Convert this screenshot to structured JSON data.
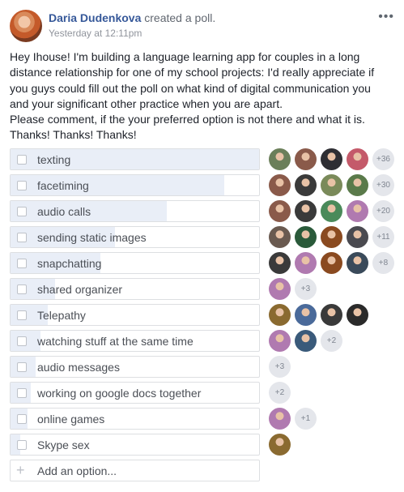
{
  "post": {
    "author_name": "Daria Dudenkova",
    "action_text": "created a poll.",
    "timestamp": "Yesterday at 12:11pm",
    "more_label": "•••",
    "text_lines": [
      "Hey Ihouse! I'm building a language learning app for couples in a long",
      "distance relationship for one of my school projects: I'd really appreciate if",
      "you guys could fill out the poll on what kind of digital communication you",
      "and your significant other practice when you are apart.",
      "Please comment, if the your preferred option is not there and what it is.",
      "Thanks! Thanks! Thanks!"
    ]
  },
  "poll": {
    "options": [
      {
        "label": "texting",
        "fill": 1.0,
        "voters": [
          "#6b7f5a",
          "#8a5a4a",
          "#2e2e33",
          "#c45a6a"
        ],
        "more": "+36"
      },
      {
        "label": "facetiming",
        "fill": 0.86,
        "voters": [
          "#8a5a4a",
          "#3a3a3a",
          "#7a8a5a",
          "#5a7a4a"
        ],
        "more": "+30"
      },
      {
        "label": "audio calls",
        "fill": 0.63,
        "voters": [
          "#8a5a4a",
          "#3a3a3a",
          "#4a8a5a",
          "#b07ab0"
        ],
        "more": "+20"
      },
      {
        "label": "sending static images",
        "fill": 0.42,
        "voters": [
          "#6a5a50",
          "#2a5a3a",
          "#8a4a20",
          "#4a4a50"
        ],
        "more": "+11"
      },
      {
        "label": "snapchatting",
        "fill": 0.36,
        "voters": [
          "#3a3a3a",
          "#b07ab0",
          "#8a4a20",
          "#3a4a5a"
        ],
        "more": "+8"
      },
      {
        "label": "shared organizer",
        "fill": 0.18,
        "voters": [
          "#b07ab0"
        ],
        "more": "+3"
      },
      {
        "label": "Telepathy",
        "fill": 0.15,
        "voters": [
          "#8a6a30",
          "#4a6a9a",
          "#3a3a3a",
          "#2a2a2a"
        ],
        "more": ""
      },
      {
        "label": "watching stuff at the same time",
        "fill": 0.12,
        "voters": [
          "#b07ab0",
          "#3a5a7a"
        ],
        "more": "+2"
      },
      {
        "label": "audio messages",
        "fill": 0.1,
        "voters": [],
        "more": "+3"
      },
      {
        "label": "working on google docs together",
        "fill": 0.08,
        "voters": [],
        "more": "+2"
      },
      {
        "label": "online games",
        "fill": 0.07,
        "voters": [
          "#b07ab0"
        ],
        "more": "+1"
      },
      {
        "label": "Skype sex",
        "fill": 0.04,
        "voters": [
          "#8a6a30"
        ],
        "more": ""
      }
    ],
    "add_option_placeholder": "Add an option...",
    "add_icon": "+"
  }
}
